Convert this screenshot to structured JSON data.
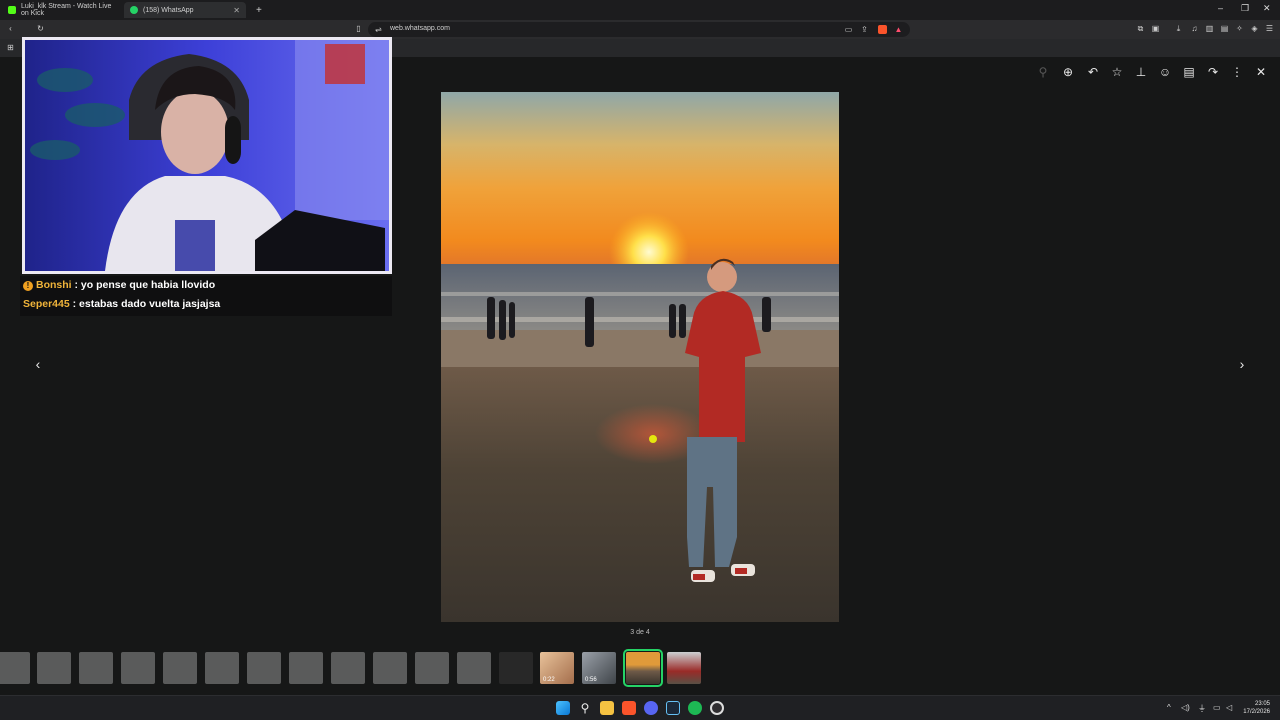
{
  "browser": {
    "tabs": [
      {
        "label": "Luki_klk Stream - Watch Live on Kick",
        "favicon": "kick-icon",
        "active": false
      },
      {
        "label": "(158) WhatsApp",
        "favicon": "whatsapp-icon",
        "active": true
      }
    ],
    "new_tab": "+",
    "url": "web.whatsapp.com",
    "window_controls": {
      "minimize": "–",
      "restore": "❐",
      "close": "✕"
    }
  },
  "viewer": {
    "counter": "3 de 4",
    "toolbar_icons": [
      "zoom-in-icon",
      "reply-icon",
      "star-icon",
      "pin-icon",
      "emoji-react-icon",
      "delete-icon",
      "forward-icon",
      "more-icon",
      "close-icon"
    ],
    "prev_glyph": "‹",
    "next_glyph": "›",
    "thumbnails": {
      "docs_count": 12,
      "media": [
        {
          "kind": "video",
          "duration": ""
        },
        {
          "kind": "video",
          "duration": "0:22"
        },
        {
          "kind": "video",
          "duration": "0:56"
        },
        {
          "kind": "image",
          "selected": true
        },
        {
          "kind": "image",
          "selected": false
        }
      ]
    }
  },
  "stream_overlay": {
    "chat": [
      {
        "user": "Bonshi",
        "message": ": yo pense que habia llovido",
        "badge": "!"
      },
      {
        "user": "Seper445",
        "message": ": estabas dado vuelta jasjajsa",
        "badge": ""
      }
    ]
  },
  "taskbar": {
    "apps": [
      "windows-start-icon",
      "search-icon",
      "file-explorer-icon",
      "brave-icon",
      "discord-icon",
      "steam-icon",
      "spotify-icon",
      "obs-icon"
    ],
    "clock_time": "23:05",
    "clock_date": "17/2/2026"
  },
  "colors": {
    "whatsapp_green": "#25d366",
    "chat_username": "#f0b43a",
    "viewer_bg": "#161717"
  }
}
